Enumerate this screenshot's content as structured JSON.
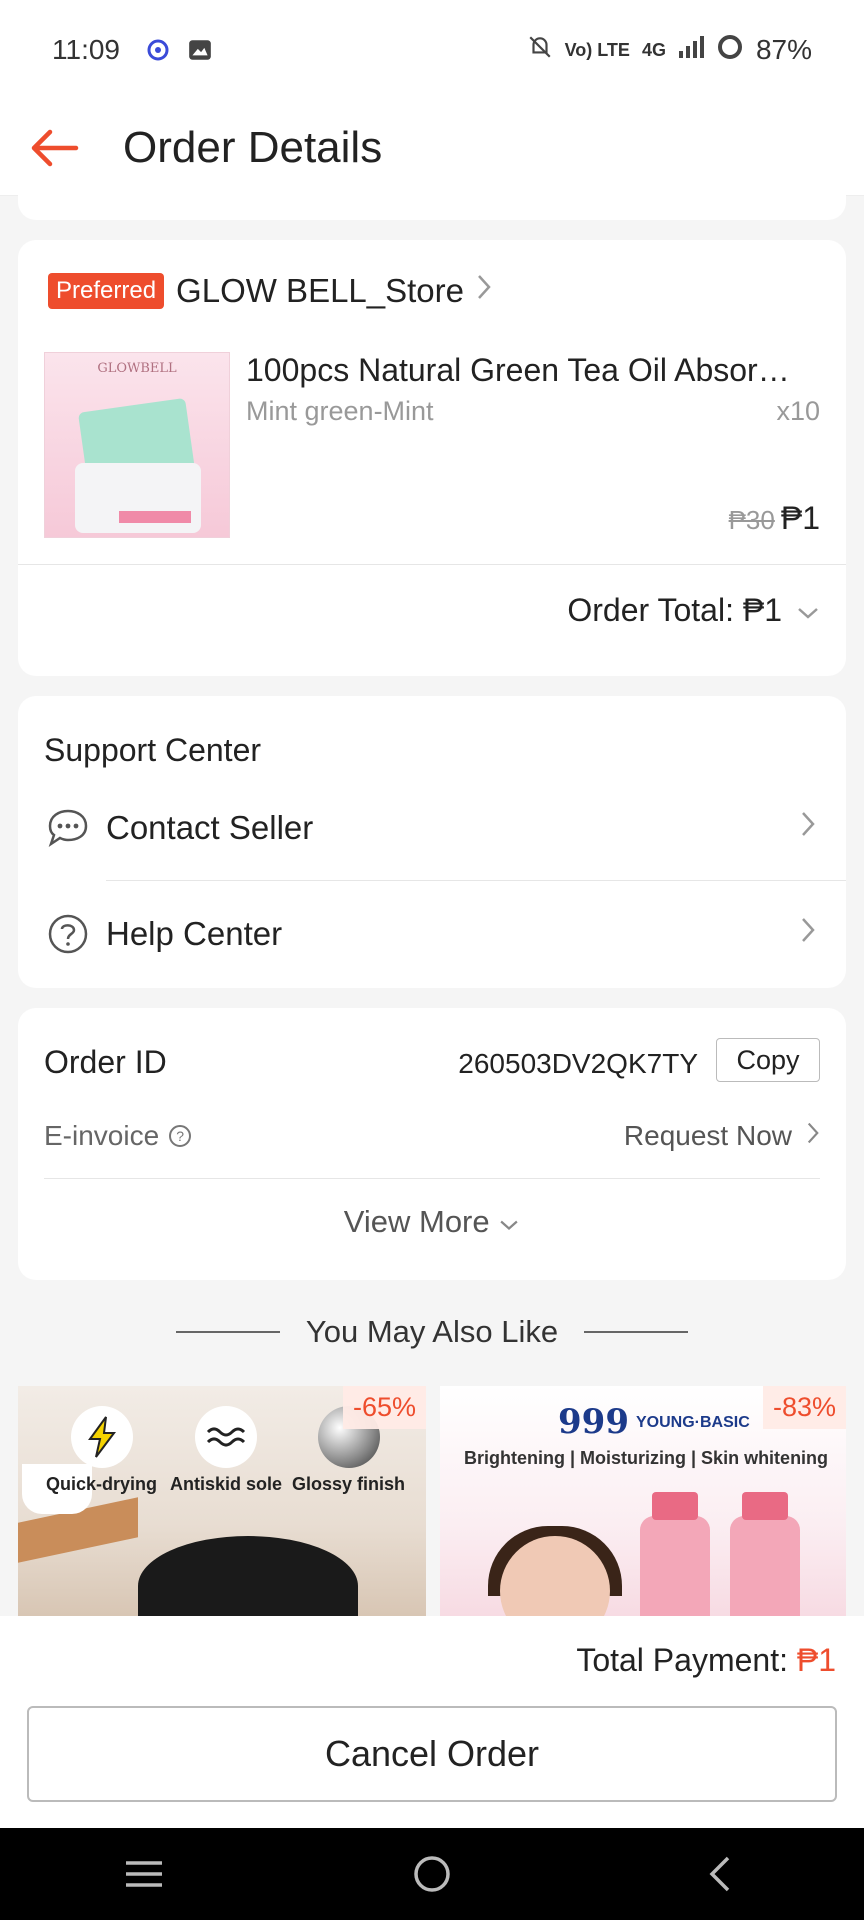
{
  "status_bar": {
    "time": "11:09",
    "volte": "Vo) LTE",
    "network": "4G",
    "battery": "87%"
  },
  "header": {
    "title": "Order Details"
  },
  "order_item": {
    "badge": "Preferred",
    "store_name": "GLOW BELL_Store",
    "product_image_brand": "GLOWBELL",
    "product_title": "100pcs Natural Green Tea Oil Absor…",
    "variant": "Mint green-Mint",
    "quantity": "x10",
    "original_price": "₱30",
    "price": "₱1",
    "order_total_label": "Order Total: ₱1"
  },
  "support": {
    "title": "Support Center",
    "contact_seller": "Contact Seller",
    "help_center": "Help Center"
  },
  "order_info": {
    "order_id_label": "Order ID",
    "order_id_value": "260503DV2QK7TY",
    "copy_label": "Copy",
    "einvoice_label": "E-invoice",
    "request_now": "Request Now",
    "view_more": "View More"
  },
  "recommendations": {
    "heading": "You May Also Like",
    "items": [
      {
        "discount": "-65%",
        "features": [
          "Quick-drying",
          "Antiskid sole",
          "Glossy finish"
        ]
      },
      {
        "discount": "-83%",
        "brand": "999",
        "brand2": "YOUNG·BASIC",
        "tagline": "Brightening | Moisturizing | Skin whitening"
      }
    ]
  },
  "footer": {
    "total_payment_label": "Total Payment: ",
    "total_payment_amount": "₱1",
    "cancel_order": "Cancel Order"
  },
  "colors": {
    "accent": "#ee4d2d",
    "background": "#f5f5f5"
  },
  "icons": [
    "back-arrow-icon",
    "chevron-right-icon",
    "chevron-down-icon",
    "chat-icon",
    "help-circle-icon",
    "question-icon",
    "menu-icon",
    "home-icon",
    "back-icon"
  ]
}
